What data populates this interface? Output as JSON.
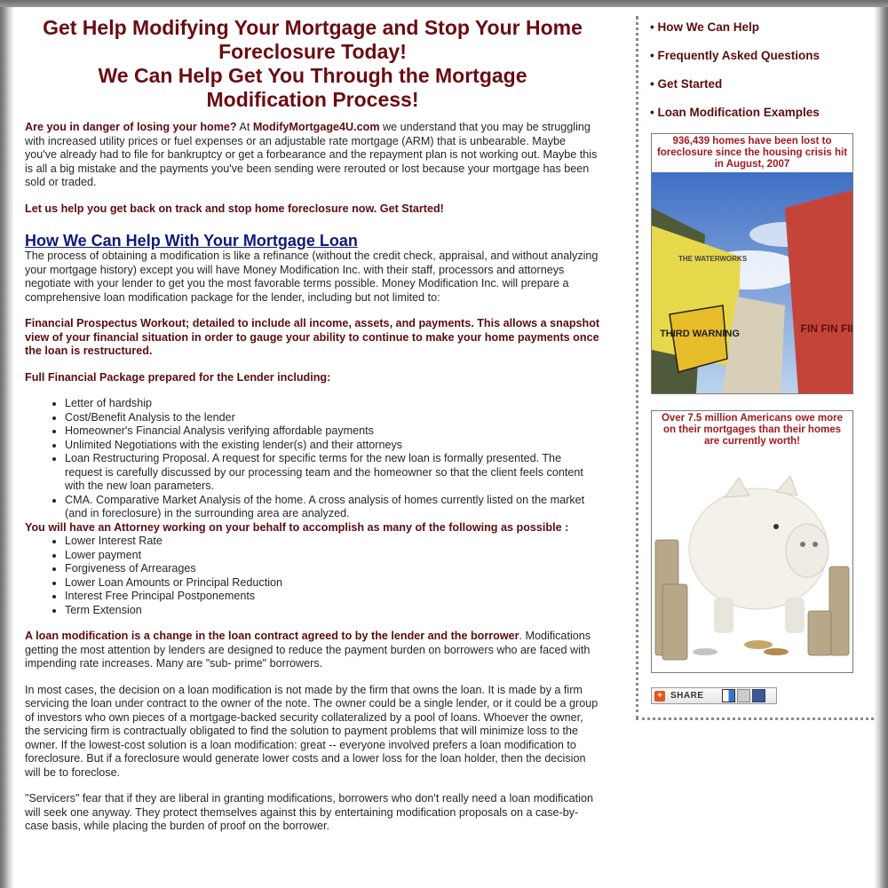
{
  "headline": {
    "line1": "Get Help Modifying Your Mortgage and Stop Your Home",
    "line2": "Foreclosure Today!",
    "line3": "We Can Help Get You Through the Mortgage",
    "line4": "Modification Process!"
  },
  "intro": {
    "lead": "Are you in danger of losing your home?",
    "at": " At ",
    "site": "ModifyMortgage4U.com",
    "rest": " we understand that you may be struggling with increased utility prices or fuel expenses or an adjustable rate mortgage (ARM) that is unbearable. Maybe you've already had to file for bankruptcy or get a forbearance and the repayment plan is not working out. Maybe this is all a big mistake and the payments you've been sending were rerouted or lost because your mortgage has been sold or traded.",
    "cta": "Let us help you get back on track and stop home foreclosure now. Get Started!"
  },
  "section": {
    "heading": "How We Can Help With Your Mortgage Loan",
    "para1": "The process of obtaining a modification is like a refinance (without the credit check, appraisal, and without analyzing your mortgage history) except you will have Money Modification Inc. with their staff, processors and attorneys negotiate with your lender to get you the most favorable terms possible. Money Modification Inc. will prepare a comprehensive loan modification package for the lender, including but not limited to:",
    "prospectus": "Financial Prospectus Workout; detailed to include all income, assets, and payments. This allows a snapshot view of your financial situation in order to gauge your ability to continue to make your home payments once the loan is restructured.",
    "package_heading": "Full Financial Package prepared for the Lender including:",
    "package_items": [
      "Letter of hardship",
      "Cost/Benefit Analysis to the lender",
      "Homeowner's Financial Analysis verifying affordable payments",
      "Unlimited Negotiations with the existing lender(s) and their attorneys",
      "Loan Restructuring Proposal. A request for specific terms for the new loan is formally presented. The request is carefully discussed by our processing team and the homeowner so that the client feels content with the new loan parameters.",
      "CMA. Comparative Market Analysis of the home. A cross analysis of homes currently listed on the market (and in foreclosure) in the surrounding area are analyzed."
    ],
    "attorney_heading": "You will have an Attorney working on your behalf to accomplish as many of the following as possible :",
    "attorney_items": [
      "Lower Interest Rate",
      "Lower payment",
      "Forgiveness of Arrearages",
      "Lower Loan Amounts or Principal Reduction",
      "Interest Free Principal Postponements",
      "Term Extension"
    ],
    "modification_lead": "A loan modification is a change in the loan contract agreed to by the lender and the borrower",
    "modification_rest": ". Modifications getting the most attention by lenders are designed to reduce the payment burden on borrowers who are faced with impending rate increases. Many are \"sub- prime\" borrowers.",
    "para_cases": "In most cases, the decision on a loan modification is not made by the firm that owns the loan. It is made by a firm servicing the loan under contract to the owner of the note. The owner could be a single lender, or it could be a group of investors who own pieces of a mortgage-backed security collateralized by a pool of loans. Whoever the owner, the servicing firm is contractually obligated to find the solution to payment problems that will minimize loss to the owner. If the lowest-cost solution is a loan modification: great -- everyone involved prefers a loan modification to foreclosure. But if a foreclosure would generate lower costs and a lower loss for the loan holder, then the decision will be to foreclose.",
    "para_servicers": "\"Servicers\" fear that if they are liberal in granting modifications, borrowers who don't really need a loan modification will seek one anyway. They protect themselves against this by entertaining modification proposals on a case-by-case basis, while placing the burden of proof on the borrower."
  },
  "sidebar": {
    "nav": [
      "How We Can Help",
      "Frequently Asked Questions",
      "Get Started",
      "Loan Modification Examples"
    ],
    "ad1_caption": "936,439 homes have been lost to foreclosure since the housing crisis hit in August, 2007",
    "ad1_art": {
      "envelope1": "THIRD WARNING",
      "envelope2": "THE WATERWORKS",
      "envelope3": "FIN FIN FIN"
    },
    "ad2_caption": "Over 7.5 million Americans owe more on their mortgages than their homes are currently worth!",
    "share_label": "SHARE"
  },
  "colors": {
    "headline": "#6b0c12",
    "link": "#0f1a7a",
    "ad_caption": "#a3191f"
  }
}
